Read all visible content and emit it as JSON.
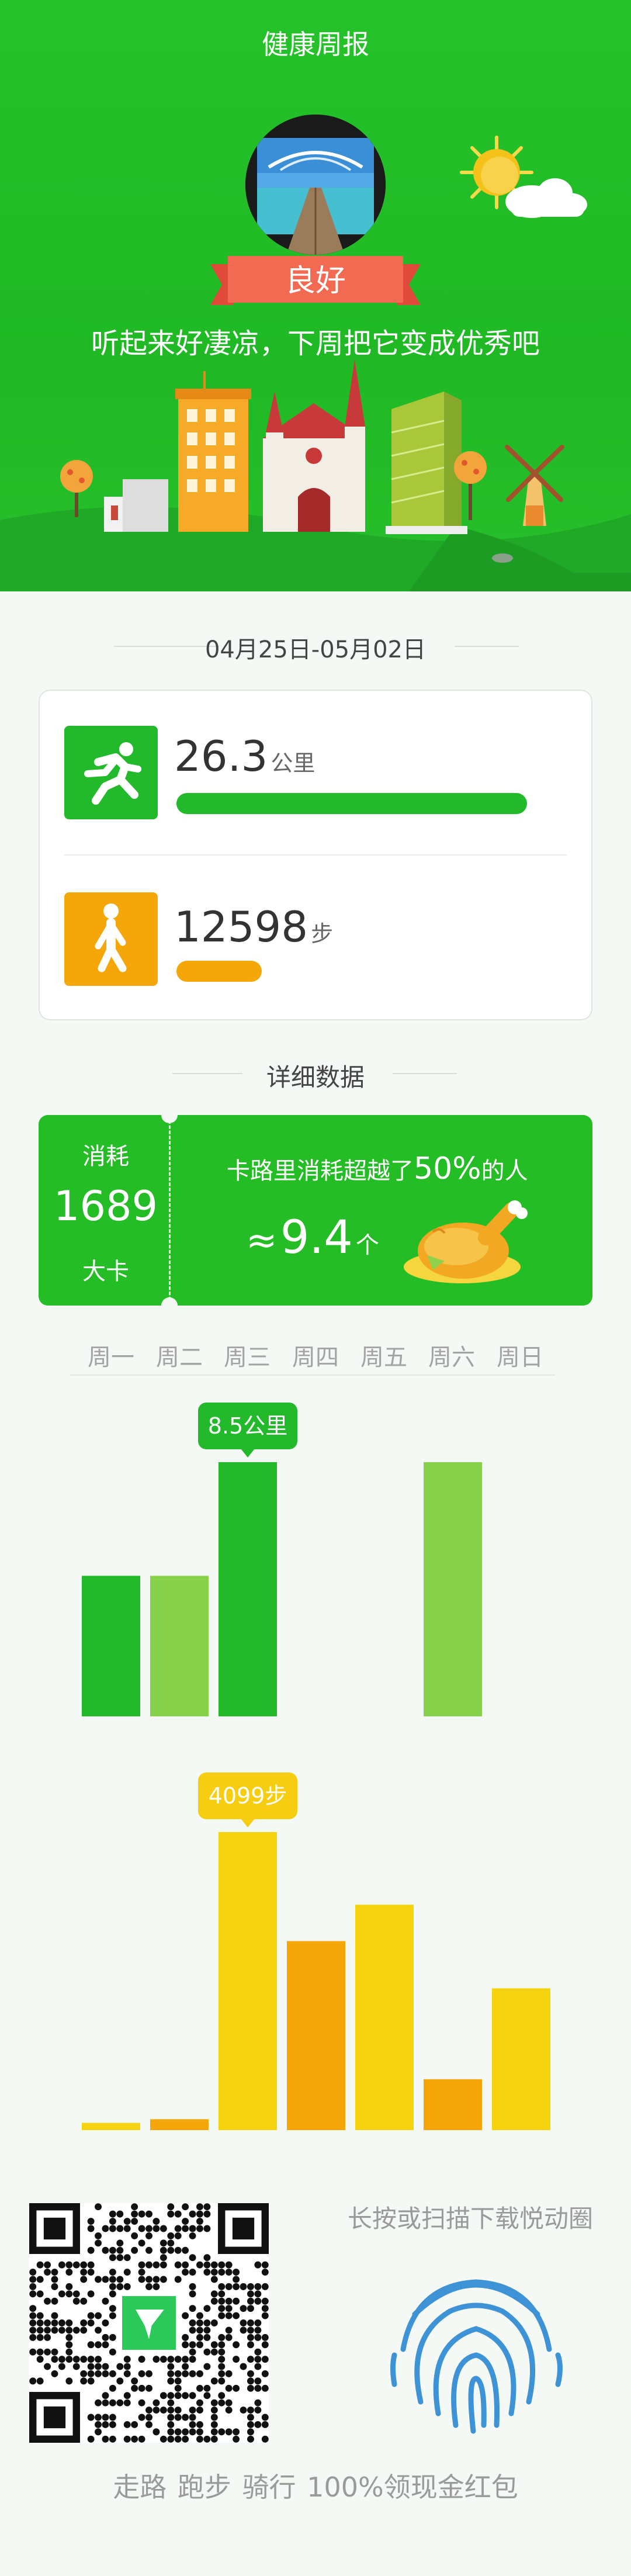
{
  "header": {
    "title": "健康周报",
    "rating": "良好",
    "comment": "听起来好凄凉，下周把它变成优秀吧"
  },
  "date_range": "04月25日-05月02日",
  "stats": {
    "distance": {
      "value": "26.3",
      "unit": "公里",
      "icon": "running-person-icon",
      "color": "#22b92a"
    },
    "steps": {
      "value": "12598",
      "unit": "步",
      "icon": "walking-person-icon",
      "color": "#f5a70a"
    }
  },
  "detail": {
    "title": "详细数据",
    "calories_label": "消耗",
    "calories_value": "1689",
    "calories_unit": "大卡",
    "compare_text": "卡路里消耗超越了",
    "compare_percent": "50%",
    "compare_suffix": "的人",
    "approx_symbol": "≈",
    "food_count": "9.4",
    "food_unit": "个",
    "food_icon": "roast-chicken-icon"
  },
  "weekdays": [
    "周一",
    "周二",
    "周三",
    "周四",
    "周五",
    "周六",
    "周日"
  ],
  "chart_data": [
    {
      "type": "bar",
      "categories": [
        "周一",
        "周二",
        "周三",
        "周四",
        "周五",
        "周六",
        "周日"
      ],
      "values": [
        4.7,
        4.7,
        8.5,
        0,
        0,
        8.5,
        0
      ],
      "unit": "公里",
      "annotation": {
        "index": 2,
        "label": "8.5公里"
      },
      "colors": [
        "#22b92a",
        "#88d14a",
        "#22b92a",
        "#22b92a",
        "#22b92a",
        "#88d14a",
        "#22b92a"
      ]
    },
    {
      "type": "bar",
      "categories": [
        "周一",
        "周二",
        "周三",
        "周四",
        "周五",
        "周六",
        "周日"
      ],
      "values": [
        100,
        150,
        4099,
        2600,
        3100,
        700,
        1950
      ],
      "unit": "步",
      "annotation": {
        "index": 2,
        "label": "4099步"
      },
      "colors": [
        "#f6d30f",
        "#f5a70a",
        "#f6d30f",
        "#f5a70a",
        "#f6d30f",
        "#f5a70a",
        "#f6d30f"
      ]
    }
  ],
  "footer": {
    "scan_text": "长按或扫描下载悦动圈",
    "promo_text": "走路 跑步 骑行 100%领现金红包",
    "qr_icon": "qr-code",
    "fingerprint_icon": "fingerprint-icon"
  }
}
